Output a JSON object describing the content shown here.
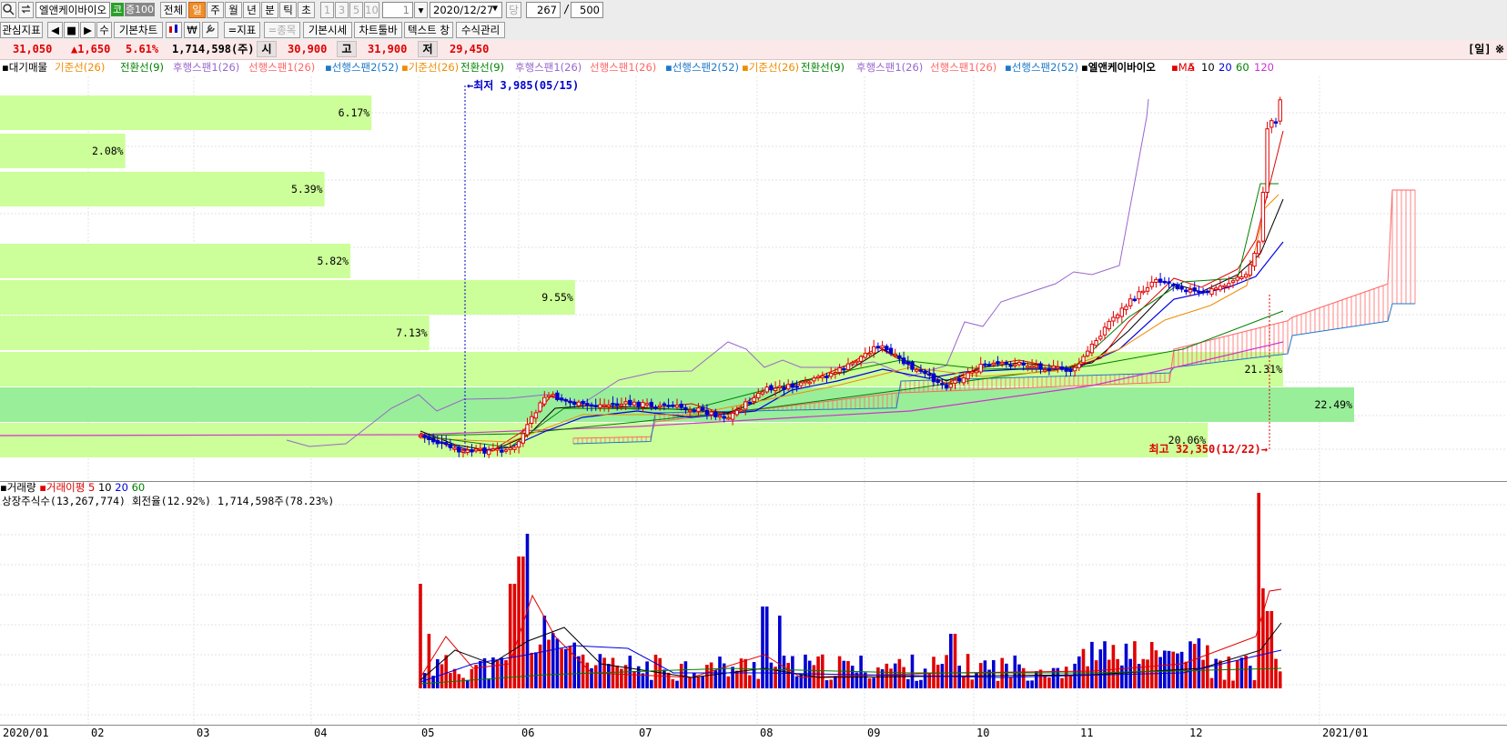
{
  "toolbar": {
    "stock_name": "엘앤케이바이오",
    "market_badge": "코",
    "margin_badge": "증100",
    "periods": [
      "전체",
      "일",
      "주",
      "월",
      "년",
      "분",
      "틱",
      "초"
    ],
    "selected_period": "일",
    "intervals": [
      "1",
      "3",
      "5",
      "10"
    ],
    "interval_value": "1",
    "date_value": "2020/12/27",
    "when_label": "당",
    "count_value": "267",
    "count_sep": "/",
    "count_total": "500",
    "row2_buttons": [
      "관심지표",
      "기본차트",
      "=지표",
      "=종목",
      "기본시세",
      "차트툴바",
      "텍스트 창",
      "수식관리"
    ],
    "row2_small": [
      "◀",
      "■",
      "▶",
      "수"
    ]
  },
  "price_bar": {
    "price": "31,050",
    "change": "▲1,650",
    "change_pct": "5.61%",
    "volume": "1,714,598(주)",
    "open_label": "시",
    "open": "30,900",
    "high_label": "고",
    "high": "31,900",
    "low_label": "저",
    "low": "29,450",
    "period_tag": "[일]"
  },
  "legend": {
    "items": [
      {
        "text": "대기매물",
        "color": "#000000"
      },
      {
        "text": "기준선(26)",
        "color": "#f08c00"
      },
      {
        "text": "전환선(9)",
        "color": "#008000"
      },
      {
        "text": "후행스팬1(26)",
        "color": "#9966cc"
      },
      {
        "text": "선행스팬1(26)",
        "color": "#ff6666"
      },
      {
        "text": "선행스팬2(52)",
        "color": "#1e78c8"
      },
      {
        "text": "기준선(26)",
        "color": "#f08c00"
      },
      {
        "text": "전환선(9)",
        "color": "#008000"
      },
      {
        "text": "후행스팬1(26)",
        "color": "#9966cc"
      },
      {
        "text": "선행스팬1(26)",
        "color": "#ff6666"
      },
      {
        "text": "선행스팬2(52)",
        "color": "#1e78c8"
      },
      {
        "text": "기준선(26)",
        "color": "#f08c00"
      },
      {
        "text": "전환선(9)",
        "color": "#008000"
      },
      {
        "text": "후행스팬1(26)",
        "color": "#9966cc"
      },
      {
        "text": "선행스팬1(26)",
        "color": "#ff6666"
      },
      {
        "text": "선행스팬2(52)",
        "color": "#1e78c8"
      },
      {
        "text": "엘앤케이바이오",
        "color": "#000000"
      },
      {
        "text": "MA",
        "color": "#e00000"
      },
      {
        "text": "5",
        "color": "#e00000"
      },
      {
        "text": "10",
        "color": "#000000"
      },
      {
        "text": "20",
        "color": "#0000e0"
      },
      {
        "text": "60",
        "color": "#008000"
      },
      {
        "text": "120",
        "color": "#cc33cc"
      }
    ]
  },
  "annotations": {
    "low_marker": "←최저 3,985(05/15)",
    "high_marker": "최고 32,350(12/22)→"
  },
  "volume_panel": {
    "title": "거래량",
    "avg_label": "거래이평",
    "avg_periods": [
      "5",
      "10",
      "20",
      "60"
    ],
    "avg_colors": [
      "#e00000",
      "#000000",
      "#0000e0",
      "#008000"
    ],
    "info": "상장주식수(13,267,774) 회전율(12.92%) 1,714,598주(78.23%)"
  },
  "x_axis": {
    "ticks": [
      "2020/01",
      "02",
      "03",
      "04",
      "05",
      "06",
      "07",
      "08",
      "09",
      "10",
      "11",
      "12",
      "2021/01"
    ]
  },
  "colors": {
    "up": "#e00000",
    "down": "#0000d0",
    "profile_band": "#ccff99",
    "profile_band_max": "#99ee99",
    "cloud_fill": "#ff6666",
    "trailing_span": "#9966cc"
  },
  "chart_data": [
    {
      "type": "bar",
      "title": "대기매물",
      "categories": [
        "band1",
        "band2",
        "band3",
        "band4",
        "band5",
        "band6",
        "band7",
        "band8",
        "band9",
        "band10"
      ],
      "values": [
        6.17,
        2.08,
        5.39,
        0,
        5.82,
        9.55,
        7.13,
        21.31,
        22.49,
        20.06
      ],
      "labels": [
        "6.17%",
        "2.08%",
        "5.39%",
        "",
        "5.82%",
        "9.55%",
        "7.13%",
        "21.31%",
        "22.49%",
        "20.06%"
      ],
      "unit": "%"
    },
    {
      "type": "line",
      "title": "엘앤케이바이오 일봉",
      "xlim": [
        "2020/01",
        "2021/01"
      ],
      "series": [
        {
          "name": "MA 5"
        },
        {
          "name": "MA 10"
        },
        {
          "name": "MA 20"
        },
        {
          "name": "MA 60"
        },
        {
          "name": "MA 120"
        }
      ],
      "low_point": {
        "date": "05/15",
        "value": 3985
      },
      "high_point": {
        "date": "12/22",
        "value": 32350
      }
    },
    {
      "type": "bar",
      "title": "거래량",
      "series": [
        {
          "name": "거래이평 5"
        },
        {
          "name": "거래이평 10"
        },
        {
          "name": "거래이평 20"
        },
        {
          "name": "거래이평 60"
        }
      ]
    }
  ]
}
